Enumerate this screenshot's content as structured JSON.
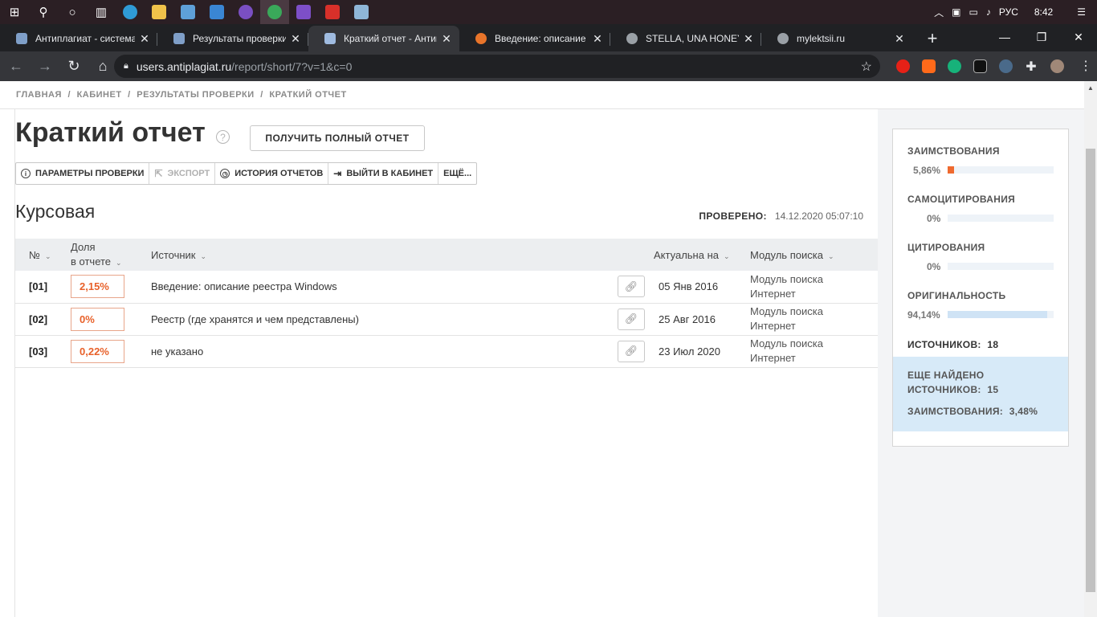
{
  "taskbar": {
    "icons": [
      "windows-start-icon",
      "search-icon",
      "cortana-icon",
      "task-view-icon",
      "edge-icon",
      "file-explorer-icon",
      "store-icon",
      "mail-icon",
      "app-icon",
      "chrome-icon",
      "visual-studio-icon",
      "acrobat-icon",
      "notepad-icon"
    ],
    "language": "РУС",
    "time": "8:42"
  },
  "tabs": [
    {
      "title": "Антиплагиат - система"
    },
    {
      "title": "Результаты проверки -"
    },
    {
      "title": "Краткий отчет - Антипл"
    },
    {
      "title": "Введение: описание ре"
    },
    {
      "title": "STELLA, UNA HONEYPO"
    },
    {
      "title": "mylektsii.ru"
    }
  ],
  "address": {
    "host": "users.antiplagiat.ru",
    "path": "/report/short/7?v=1&c=0"
  },
  "breadcrumb": [
    "ГЛАВНАЯ",
    "/",
    "КАБИНЕТ",
    "/",
    "РЕЗУЛЬТАТЫ ПРОВЕРКИ",
    "/",
    "КРАТКИЙ ОТЧЕТ"
  ],
  "header": {
    "title": "Краткий отчет",
    "help": "?",
    "full_report_button": "ПОЛУЧИТЬ ПОЛНЫЙ ОТЧЕТ"
  },
  "toolbar": {
    "params": "ПАРАМЕТРЫ ПРОВЕРКИ",
    "export": "ЭКСПОРТ",
    "history": "ИСТОРИЯ ОТЧЕТОВ",
    "exit": "ВЫЙТИ В КАБИНЕТ",
    "more": "ЕЩЁ..."
  },
  "document": {
    "name": "Курсовая",
    "checked_label": "ПРОВЕРЕНО:",
    "checked_date": "14.12.2020 05:07:10"
  },
  "table": {
    "headers": {
      "num": "№",
      "share1": "Доля",
      "share2": "в отчете",
      "source": "Источник",
      "actual": "Актуальна на",
      "module": "Модуль поиска"
    },
    "rows": [
      {
        "num": "[01]",
        "share": "2,15%",
        "source": "Введение: описание реестра Windows",
        "date": "05 Янв 2016",
        "module1": "Модуль поиска",
        "module2": "Интернет"
      },
      {
        "num": "[02]",
        "share": "0%",
        "source": "Реестр (где хранятся и чем представлены)",
        "date": "25 Авг 2016",
        "module1": "Модуль поиска",
        "module2": "Интернет"
      },
      {
        "num": "[03]",
        "share": "0,22%",
        "source": "не указано",
        "date": "23 Июл 2020",
        "module1": "Модуль поиска",
        "module2": "Интернет"
      }
    ]
  },
  "stats": {
    "borrow": {
      "label": "ЗАИМСТВОВАНИЯ",
      "value": "5,86%",
      "fraction": 0.0586,
      "color": "#ef6a2f"
    },
    "self": {
      "label": "САМОЦИТИРОВАНИЯ",
      "value": "0%",
      "fraction": 0,
      "color": "#7fb3e0"
    },
    "cite": {
      "label": "ЦИТИРОВАНИЯ",
      "value": "0%",
      "fraction": 0,
      "color": "#7fb3e0"
    },
    "orig": {
      "label": "ОРИГИНАЛЬНОСТЬ",
      "value": "94,14%",
      "fraction": 0.9414,
      "color": "#cfe3f5"
    },
    "sources_label": "ИСТОЧНИКОВ:",
    "sources_value": "18",
    "more_found_1": "ЕЩЕ НАЙДЕНО",
    "more_found_2": "ИСТОЧНИКОВ:",
    "more_found_value": "15",
    "more_borrow_label": "ЗАИМСТВОВАНИЯ:",
    "more_borrow_value": "3,48%"
  }
}
